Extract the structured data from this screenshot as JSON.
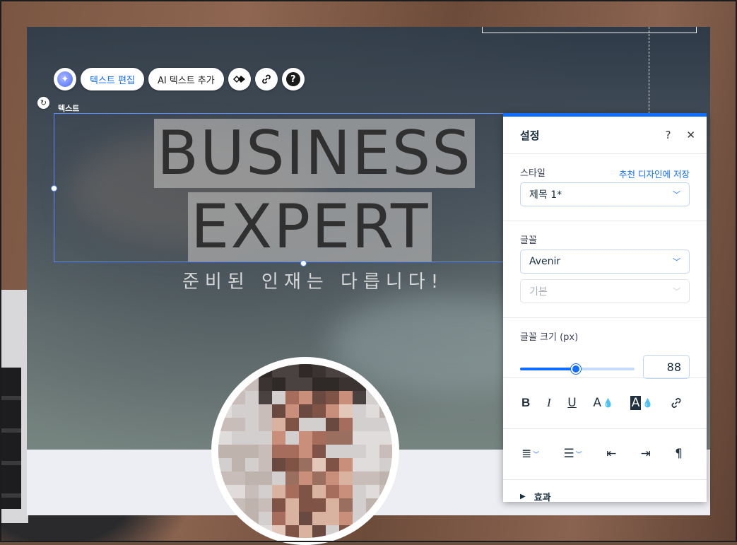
{
  "toolbar": {
    "edit_text": "텍스트 편집",
    "ai_add_text": "AI 텍스트 추가"
  },
  "selection": {
    "element_label": "텍스트"
  },
  "canvas": {
    "headline_line1": "BUSINESS",
    "headline_line2": "EXPERT",
    "subtitle": "준비된 인재는 다릅니다!"
  },
  "panel": {
    "title": "설정",
    "style": {
      "label": "스타일",
      "save_link": "추천 디자인에 저장",
      "value": "제목 1*"
    },
    "font": {
      "label": "글꼴",
      "family": "Avenir",
      "weight_placeholder": "기본"
    },
    "font_size": {
      "label": "글꼴 크기 (px)",
      "value": "88",
      "slider_fraction": 0.48
    },
    "effects_label": "효과"
  },
  "colors": {
    "accent": "#116dff"
  },
  "icons": [
    "ai-sparkle-icon",
    "animation-icon",
    "link-icon",
    "help-icon",
    "rotate-icon",
    "bold-icon",
    "italic-icon",
    "underline-icon",
    "text-color-icon",
    "highlight-color-icon",
    "link-icon",
    "align-icon",
    "list-icon",
    "indent-decrease-icon",
    "indent-increase-icon",
    "rtl-icon",
    "triangle-right-icon"
  ]
}
